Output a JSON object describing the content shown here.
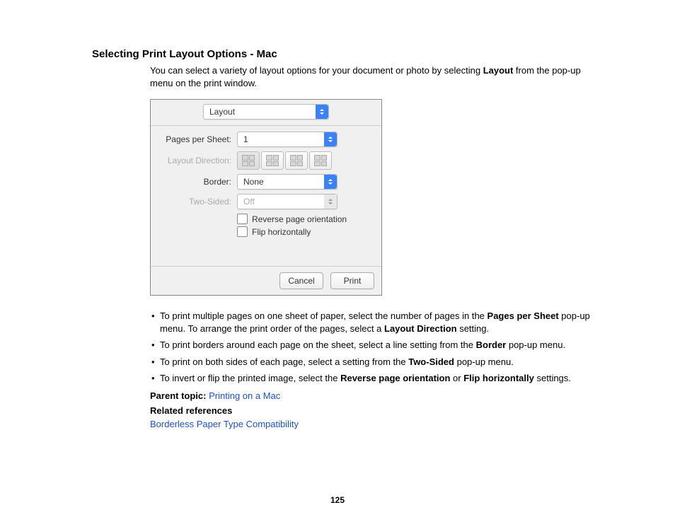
{
  "title": "Selecting Print Layout Options - Mac",
  "intro_pre": "You can select a variety of layout options for your document or photo by selecting ",
  "intro_bold": "Layout",
  "intro_post": " from the pop-up menu on the print window.",
  "dialog": {
    "main_popup": "Layout",
    "labels": {
      "pages_per_sheet": "Pages per Sheet:",
      "layout_direction": "Layout Direction:",
      "border": "Border:",
      "two_sided": "Two-Sided:"
    },
    "values": {
      "pages_per_sheet": "1",
      "border": "None",
      "two_sided": "Off"
    },
    "checkboxes": {
      "reverse": "Reverse page orientation",
      "flip": "Flip horizontally"
    },
    "buttons": {
      "cancel": "Cancel",
      "print": "Print"
    }
  },
  "bullets": {
    "b1_pre": "To print multiple pages on one sheet of paper, select the number of pages in the ",
    "b1_bold1": "Pages per Sheet",
    "b1_mid": " pop-up menu. To arrange the print order of the pages, select a ",
    "b1_bold2": "Layout Direction",
    "b1_post": " setting.",
    "b2_pre": "To print borders around each page on the sheet, select a line setting from the ",
    "b2_bold": "Border",
    "b2_post": " pop-up menu.",
    "b3_pre": "To print on both sides of each page, select a setting from the ",
    "b3_bold": "Two-Sided",
    "b3_post": " pop-up menu.",
    "b4_pre": "To invert or flip the printed image, select the ",
    "b4_bold1": "Reverse page orientation",
    "b4_mid": " or ",
    "b4_bold2": "Flip horizontally",
    "b4_post": " settings."
  },
  "parent_topic_label": "Parent topic:",
  "parent_topic_link": "Printing on a Mac",
  "related_refs_label": "Related references",
  "related_link": "Borderless Paper Type Compatibility",
  "page_number": "125"
}
